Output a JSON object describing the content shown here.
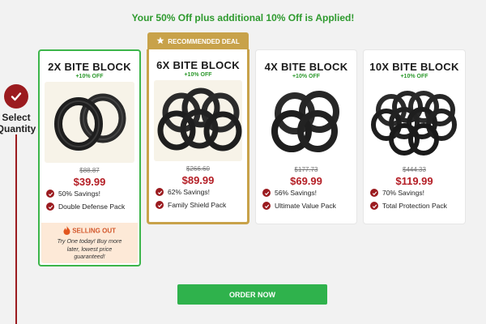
{
  "banner": "Your 50% Off plus additional 10% Off is Applied!",
  "step": {
    "label_line1": "Select",
    "label_line2": "Quantity"
  },
  "recommended_label": "RECOMMENDED DEAL",
  "cards": [
    {
      "title": "2X BITE BLOCK",
      "off": "+10% OFF",
      "old_price": "$88.87",
      "price": "$39.99",
      "features": [
        "50% Savings!",
        "Double Defense Pack"
      ],
      "selected": true,
      "band_count": 2
    },
    {
      "title": "6X BITE BLOCK",
      "off": "+10% OFF",
      "old_price": "$266.60",
      "price": "$89.99",
      "features": [
        "62% Savings!",
        "Family Shield Pack"
      ],
      "recommended": true,
      "band_count": 6
    },
    {
      "title": "4X BITE BLOCK",
      "off": "+10% OFF",
      "old_price": "$177.73",
      "price": "$69.99",
      "features": [
        "56% Savings!",
        "Ultimate Value Pack"
      ],
      "band_count": 4
    },
    {
      "title": "10X BITE BLOCK",
      "off": "+10% OFF",
      "old_price": "$444.33",
      "price": "$119.99",
      "features": [
        "70% Savings!",
        "Total Protection Pack"
      ],
      "band_count": 10
    }
  ],
  "sellout": {
    "title": "SELLING OUT",
    "text": "Try One today! Buy more later, lowest price guaranteed!"
  },
  "order_button": "ORDER NOW",
  "colors": {
    "accent_green": "#2fb24c",
    "brand_red": "#9b1b1f",
    "gold": "#c8a24a"
  }
}
